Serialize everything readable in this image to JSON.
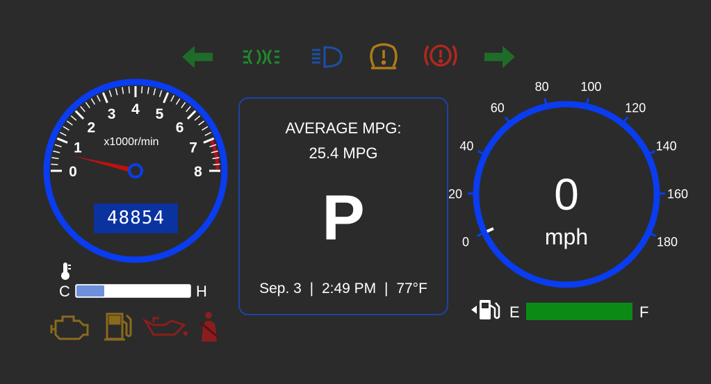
{
  "indicators_top": [
    {
      "name": "left-turn-signal-icon",
      "color": "#1f6b2a"
    },
    {
      "name": "parking-lights-icon",
      "color": "#1f8a2a"
    },
    {
      "name": "high-beam-icon",
      "color": "#1c4fa8"
    },
    {
      "name": "tire-pressure-warning-icon",
      "color": "#b07a18"
    },
    {
      "name": "brake-warning-icon",
      "color": "#b0281e"
    },
    {
      "name": "right-turn-signal-icon",
      "color": "#1f6b2a"
    }
  ],
  "tachometer": {
    "unit_label": "x1000r/min",
    "tick_labels": [
      "0",
      "1",
      "2",
      "3",
      "4",
      "5",
      "6",
      "7",
      "8"
    ],
    "needle_value": 1,
    "odometer": "48854",
    "accent_color": "#0a3cf0",
    "redline_color": "#b0101a"
  },
  "center": {
    "mpg_label": "AVERAGE MPG:",
    "mpg_value": "25.4 MPG",
    "gear": "P",
    "date": "Sep. 3",
    "time": "2:49 PM",
    "temperature": "77°F",
    "separator": "|"
  },
  "speedometer": {
    "value": "0",
    "unit": "mph",
    "tick_labels": [
      "0",
      "20",
      "40",
      "60",
      "80",
      "100",
      "120",
      "140",
      "160",
      "180"
    ],
    "accent_color": "#0a3cf0"
  },
  "temperature_gauge": {
    "icon": "thermometer-icon",
    "cold_label": "C",
    "hot_label": "H",
    "level_percent": 24
  },
  "fuel_gauge": {
    "icon": "fuel-pump-icon",
    "empty_label": "E",
    "full_label": "F",
    "level_percent": 100,
    "color": "#0b8a16"
  },
  "indicators_bottom": [
    {
      "name": "check-engine-icon",
      "color": "#8a6a1c"
    },
    {
      "name": "low-fuel-icon",
      "color": "#8a6a1c"
    },
    {
      "name": "oil-pressure-icon",
      "color": "#8a1e1e"
    },
    {
      "name": "seatbelt-warning-icon",
      "color": "#8a1e1e"
    }
  ]
}
